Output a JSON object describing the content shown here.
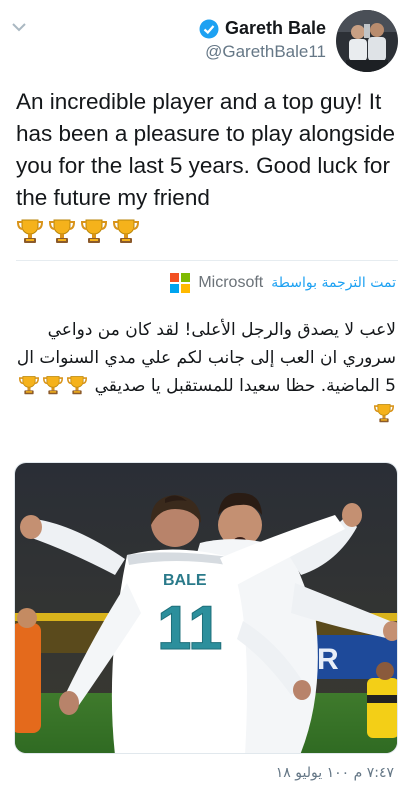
{
  "header": {
    "display_name": "Gareth Bale",
    "handle": "@GarethBale11",
    "verified": true
  },
  "tweet": {
    "text": "An incredible player and a top guy! It has been a pleasure to play alongside you for the last 5 years. Good luck for the future my friend",
    "emoji_count": 4,
    "emoji": "trophy-icon"
  },
  "translation": {
    "translated_by": "تمت الترجمة بواسطة",
    "provider": "Microsoft",
    "text": "لاعب لا يصدق والرجل الأعلى! لقد كان من دواعي سروري ان العب إلى جانب لكم علي مدي السنوات ال 5 الماضية. حظا سعيدا للمستقبل يا صديقي",
    "emoji_count": 4
  },
  "media": {
    "shirt_name": "BALE",
    "shirt_number": "11"
  },
  "timestamp": "٧:٤٧ م ١٠٠ يوليو ١٨",
  "colors": {
    "link": "#1da1f2",
    "verified": "#1da1f2",
    "text": "#14171a",
    "secondary": "#657786",
    "trophy": "#f5a623"
  }
}
